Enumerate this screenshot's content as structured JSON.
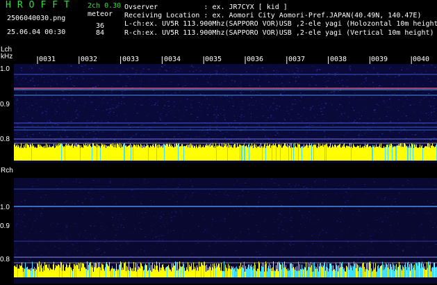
{
  "header": {
    "app_title": "HROFFT",
    "channel_mode": "2ch 0.30",
    "file_name": "2506040030.png",
    "detection_label": "meteor",
    "l_count": "36",
    "r_count": "84",
    "datetime": "25.06.04 00:30",
    "observer_label": "Ovserver",
    "observer_value": ": ex. JR7CYX [ kid ]",
    "location_label": "Receiving Location",
    "location_value": ": ex. Aomori City Aomori-Pref.JAPAN(40.49N, 140.47E)",
    "lch_info": "L-ch:ex. UV5R 113.900Mhz(SAPPORO VOR)USB ,2-ele yagi (Holozontal 10m height)",
    "rch_info": "R-ch:ex. UV5R 113.900Mhz(SAPPORO VOR)USB ,2-ele yagi (Vertical 10m height)"
  },
  "lch": {
    "label": "Lch",
    "unit": "kHz",
    "y_ticks": [
      "1.0",
      "0.9",
      "0.8"
    ]
  },
  "rch": {
    "label": "Rch",
    "y_ticks": [
      "1.0",
      "0.9",
      "0.8"
    ]
  },
  "time_ticks": [
    "0031",
    "0032",
    "0033",
    "0034",
    "0035",
    "0036",
    "0037",
    "0038",
    "0039",
    "0040"
  ],
  "colors": {
    "background": "#000000",
    "spectrogram_base": "#0a0a40",
    "signal_line": "#4aa0ff",
    "strong_signal": "#ff6aa0",
    "level_yellow": "#ffff00",
    "level_cyan": "#40e0ff",
    "title_green": "#2ee03a"
  }
}
